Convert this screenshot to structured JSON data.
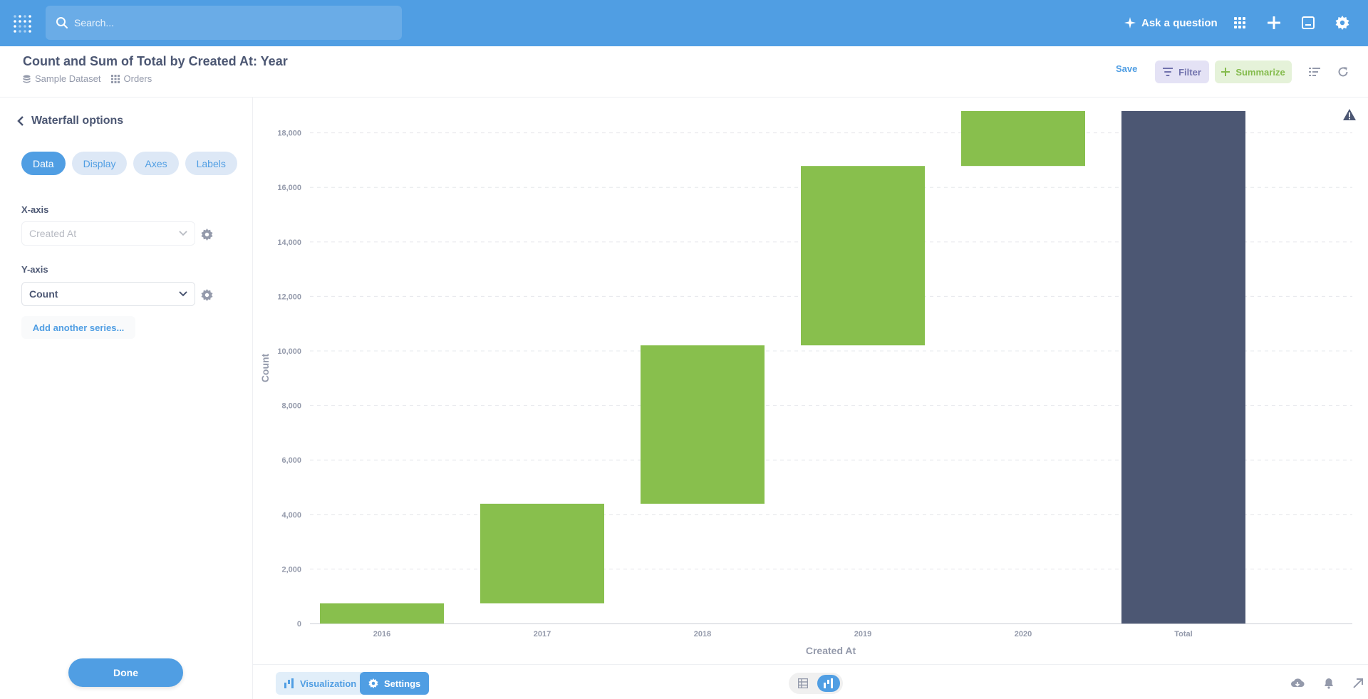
{
  "nav": {
    "search_placeholder": "Search...",
    "ask_label": "Ask a question",
    "brand_color": "#509ee3"
  },
  "header": {
    "title": "Count and Sum of Total by Created At: Year",
    "database": "Sample Dataset",
    "table": "Orders",
    "save_label": "Save",
    "filter_label": "Filter",
    "summarize_label": "Summarize"
  },
  "sidebar": {
    "back_label": "Waterfall options",
    "tabs": [
      "Data",
      "Display",
      "Axes",
      "Labels"
    ],
    "active_tab": "Data",
    "x_axis_label": "X-axis",
    "x_axis_value": "Created At",
    "y_axis_label": "Y-axis",
    "y_axis_value": "Count",
    "add_series_label": "Add another series...",
    "done_label": "Done"
  },
  "footer": {
    "visualization_label": "Visualization",
    "settings_label": "Settings"
  },
  "chart_data": {
    "type": "bar",
    "subtype": "waterfall",
    "title": "",
    "xlabel": "Created At",
    "ylabel": "Count",
    "categories": [
      "2016",
      "2017",
      "2018",
      "2019",
      "2020",
      "Total"
    ],
    "values": [
      744,
      3648,
      5813,
      6580,
      2015,
      18800
    ],
    "ylim": [
      0,
      18800
    ],
    "yticks": [
      0,
      2000,
      4000,
      6000,
      8000,
      10000,
      12000,
      14000,
      16000,
      18000
    ],
    "ytick_labels": [
      "0",
      "2,000",
      "4,000",
      "6,000",
      "8,000",
      "10,000",
      "12,000",
      "14,000",
      "16,000",
      "18,000"
    ],
    "increase_color": "#88bf4d",
    "total_color": "#4c5773",
    "grid": true
  }
}
